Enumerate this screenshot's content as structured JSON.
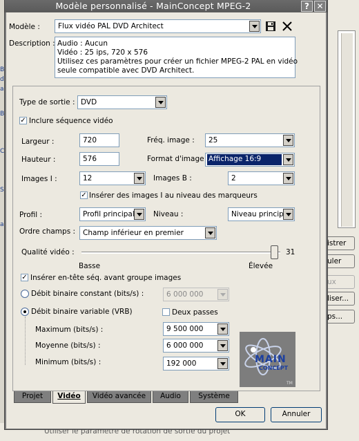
{
  "window": {
    "title": "Modèle personnalisé - MainConcept MPEG-2",
    "help_glyph": "?",
    "close_glyph": "✕"
  },
  "background": {
    "buttons": [
      "istrer",
      "uler",
      "ux",
      "liser...",
      "ps..."
    ],
    "bottom_text": "Utiliser le paramètre de rotation de sortie du projet",
    "left_marks": [
      "B",
      "d",
      "a",
      "B",
      "C",
      "S",
      "a"
    ]
  },
  "template": {
    "label": "Modèle :",
    "value": "Flux vidéo PAL DVD Architect"
  },
  "description": {
    "label": "Description :",
    "lines": [
      "Audio : Aucun",
      "Vidéo : 25 ips, 720 x 576",
      "Utilisez ces paramètres pour créer un fichier MPEG-2 PAL en vidéo",
      "seule compatible avec DVD Architect."
    ]
  },
  "video": {
    "output_type": {
      "label": "Type de sortie :",
      "value": "DVD"
    },
    "include_video": {
      "label": "Inclure séquence vidéo",
      "checked": true
    },
    "width": {
      "label": "Largeur :",
      "value": "720"
    },
    "frame_rate": {
      "label": "Fréq. image :",
      "value": "25"
    },
    "height": {
      "label": "Hauteur :",
      "value": "576"
    },
    "aspect": {
      "label": "Format d'image :",
      "value": "Affichage 16:9"
    },
    "i_frames": {
      "label": "Images I :",
      "value": "12"
    },
    "b_frames": {
      "label": "Images B :",
      "value": "2"
    },
    "insert_i": {
      "label": "Insérer des images I au niveau des marqueurs",
      "checked": true
    },
    "profile": {
      "label": "Profil :",
      "value": "Profil principal"
    },
    "level": {
      "label": "Niveau :",
      "value": "Niveau principal"
    },
    "field_order": {
      "label": "Ordre champs :",
      "value": "Champ inférieur en premier"
    },
    "quality": {
      "label": "Qualité vidéo :",
      "value": "31",
      "low": "Basse",
      "high": "Élevée",
      "level": 0.97
    },
    "insert_header": {
      "label": "Insérer en-tête séq. avant groupe images",
      "checked": true
    },
    "cbr": {
      "label": "Débit binaire constant (bits/s) :",
      "value": "6 000 000",
      "selected": false
    },
    "vbr": {
      "label": "Débit binaire variable (VRB)",
      "selected": true
    },
    "two_pass": {
      "label": "Deux passes",
      "checked": false
    },
    "maximum": {
      "label": "Maximum (bits/s) :",
      "value": "9 500 000"
    },
    "average": {
      "label": "Moyenne (bits/s) :",
      "value": "6 000 000"
    },
    "minimum": {
      "label": "Minimum (bits/s) :",
      "value": "192 000"
    }
  },
  "logo": {
    "text": "MAIN",
    "sub": "CONCEPT",
    "tm": "TM"
  },
  "tabs": [
    "Projet",
    "Vidéo",
    "Vidéo avancée",
    "Audio",
    "Système"
  ],
  "buttons": {
    "ok": "OK",
    "cancel": "Annuler"
  },
  "colors": {
    "accent": "#0a246a",
    "titlebar": "#5f5f5f",
    "face": "#ece9e0"
  }
}
